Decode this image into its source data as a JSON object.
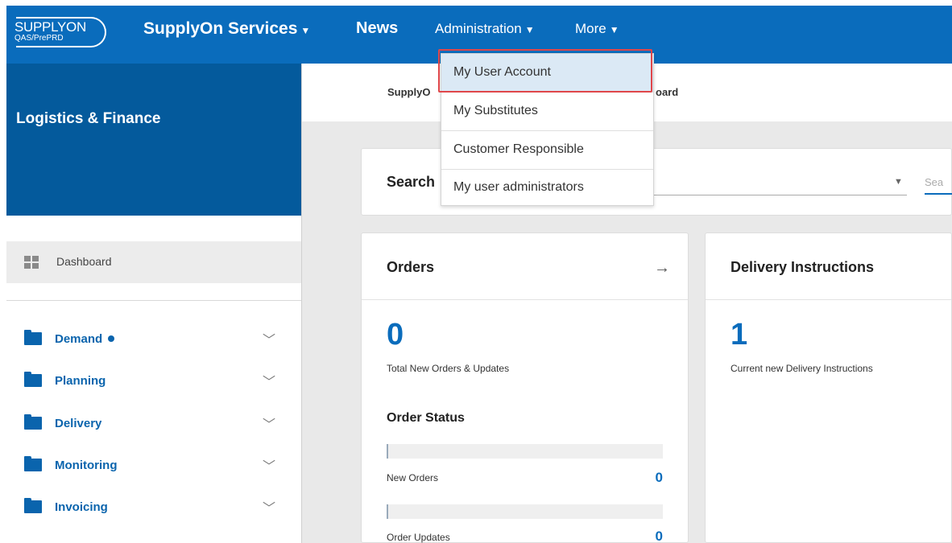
{
  "header": {
    "logo_text": "SUPPLYON",
    "logo_sub": "QAS/PrePRD",
    "brand_menu": "SupplyOn Services",
    "news": "News",
    "administration": "Administration",
    "more": "More",
    "caret": "▼"
  },
  "admin_menu": {
    "items": [
      {
        "label": "My User Account"
      },
      {
        "label": "My Substitutes"
      },
      {
        "label": "Customer Responsible"
      },
      {
        "label": "My user administrators"
      }
    ]
  },
  "sidebar": {
    "title": "Logistics & Finance",
    "dashboard": "Dashboard",
    "items": [
      {
        "label": "Demand"
      },
      {
        "label": "Planning"
      },
      {
        "label": "Delivery"
      },
      {
        "label": "Monitoring"
      },
      {
        "label": "Invoicing"
      }
    ],
    "chevron": "﹀"
  },
  "breadcrumb": {
    "part1": "SupplyO",
    "part2": "oard"
  },
  "search": {
    "label": "Search",
    "placeholder": "Sea",
    "caret": "▼"
  },
  "orders": {
    "title": "Orders",
    "arrow": "→",
    "total": "0",
    "total_label": "Total New Orders & Updates",
    "status_title": "Order Status",
    "rows": [
      {
        "label": "New Orders",
        "value": "0"
      },
      {
        "label": "Order Updates",
        "value": "0"
      }
    ]
  },
  "delivery": {
    "title": "Delivery Instructions",
    "count": "1",
    "count_label": "Current new Delivery Instructions"
  },
  "colors": {
    "header_blue": "#0a6cbc",
    "sidebar_blue": "#045a9c",
    "highlight_red": "#e0474a"
  }
}
